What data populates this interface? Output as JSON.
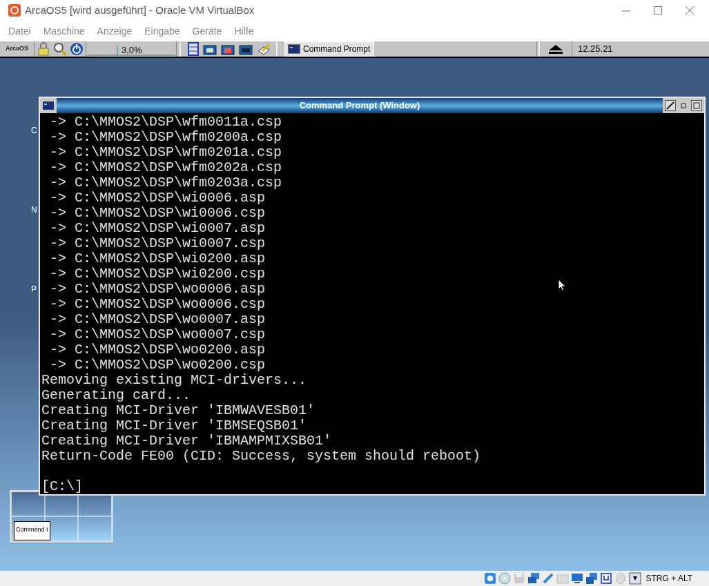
{
  "window": {
    "title": "ArcaOS5 [wird ausgeführt] - Oracle VM VirtualBox"
  },
  "menu": [
    "Datei",
    "Maschine",
    "Anzeige",
    "Eingabe",
    "Geräte",
    "Hilfe"
  ],
  "ecenter": {
    "logo": "ArcaOS",
    "cpu_reading": "3,0%",
    "tasks": [
      {
        "label": "Command Prompt",
        "selected": true
      }
    ],
    "clock": "12.25.21"
  },
  "desktop_icons": [
    {
      "label": "C"
    },
    {
      "label": "N"
    },
    {
      "label": "P"
    }
  ],
  "console": {
    "title": "Command Prompt (Window)",
    "lines": [
      " -> C:\\MMOS2\\DSP\\wfm0011a.csp",
      " -> C:\\MMOS2\\DSP\\wfm0200a.csp",
      " -> C:\\MMOS2\\DSP\\wfm0201a.csp",
      " -> C:\\MMOS2\\DSP\\wfm0202a.csp",
      " -> C:\\MMOS2\\DSP\\wfm0203a.csp",
      " -> C:\\MMOS2\\DSP\\wi0006.asp",
      " -> C:\\MMOS2\\DSP\\wi0006.csp",
      " -> C:\\MMOS2\\DSP\\wi0007.asp",
      " -> C:\\MMOS2\\DSP\\wi0007.csp",
      " -> C:\\MMOS2\\DSP\\wi0200.asp",
      " -> C:\\MMOS2\\DSP\\wi0200.csp",
      " -> C:\\MMOS2\\DSP\\wo0006.asp",
      " -> C:\\MMOS2\\DSP\\wo0006.csp",
      " -> C:\\MMOS2\\DSP\\wo0007.asp",
      " -> C:\\MMOS2\\DSP\\wo0007.csp",
      " -> C:\\MMOS2\\DSP\\wo0200.asp",
      " -> C:\\MMOS2\\DSP\\wo0200.csp",
      "Removing existing MCI-drivers...",
      "Generating card...",
      "Creating MCI-Driver 'IBMWAVESB01'",
      "Creating MCI-Driver 'IBMSEQSB01'",
      "Creating MCI-Driver 'IBMAMPMIXSB01'",
      "Return-Code FE00 (CID: Success, system should reboot)"
    ],
    "prompt": "[C:\\]"
  },
  "window_list": {
    "mini_window": "Command I"
  },
  "status_bar": {
    "host_key": "STRG + ALT"
  }
}
